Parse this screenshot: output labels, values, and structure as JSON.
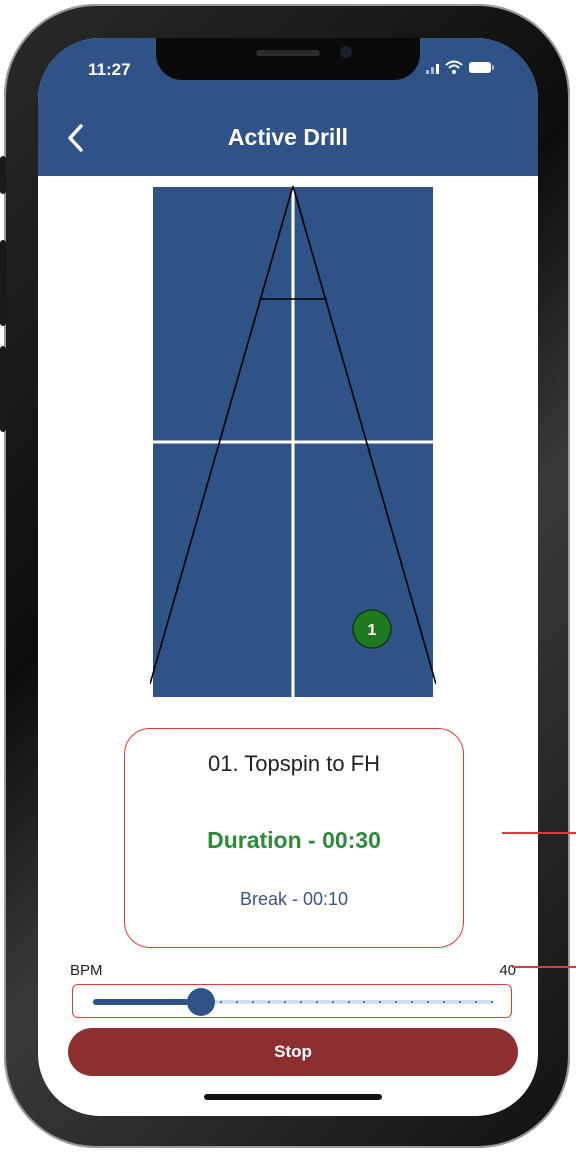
{
  "status_bar": {
    "time": "11:27"
  },
  "header": {
    "title": "Active Drill"
  },
  "court": {
    "ball_number": "1",
    "ball_color": "#1f7a1f",
    "court_color": "#2f5387"
  },
  "drill": {
    "name": "01. Topspin to FH",
    "duration": "Duration - 00:30",
    "break": "Break - 00:10"
  },
  "bpm": {
    "label": "BPM",
    "value": "40",
    "slider_level": 0.27
  },
  "actions": {
    "stop_label": "Stop"
  },
  "colors": {
    "accent": "#2f5387",
    "stop": "#8e2f2f",
    "duration_text": "#2d8a3a",
    "annotation": "#e03a3a"
  }
}
